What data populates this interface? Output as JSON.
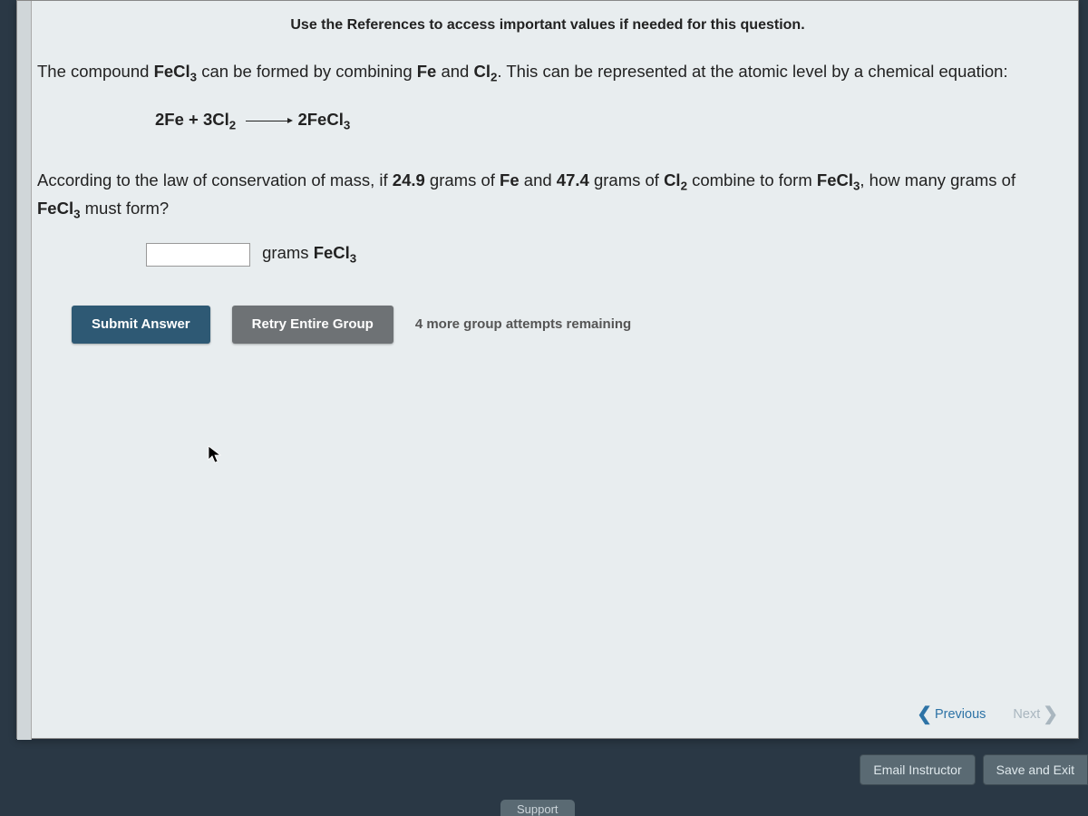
{
  "hint": "Use the References to access important values if needed for this question.",
  "question": {
    "intro_before_compound": "The compound ",
    "compound": "FeCl",
    "compound_sub": "3",
    "intro_mid": " can be formed by combining ",
    "reactant1": "Fe",
    "intro_and": " and ",
    "reactant2": "Cl",
    "reactant2_sub": "2",
    "intro_after": ". This can be represented at the atomic level by a chemical equation:"
  },
  "equation": {
    "left": "2Fe + 3Cl",
    "left_sub": "2",
    "right": "2FeCl",
    "right_sub": "3"
  },
  "conservation": {
    "pre": "According to the law of conservation of mass, if ",
    "mass1": "24.9",
    "mass1_unit": " grams of ",
    "species1": "Fe",
    "mid1": " and ",
    "mass2": "47.4",
    "mass2_unit": " grams of ",
    "species2": "Cl",
    "species2_sub": "2",
    "mid2": " combine to form ",
    "product": "FeCl",
    "product_sub": "3",
    "post": ", how many grams of ",
    "product2": "FeCl",
    "product2_sub": "3",
    "post2": " must form?"
  },
  "answer": {
    "unit_prefix": "grams ",
    "unit_species": "FeCl",
    "unit_sub": "3"
  },
  "buttons": {
    "submit": "Submit Answer",
    "retry": "Retry Entire Group",
    "attempts": "4 more group attempts remaining"
  },
  "nav": {
    "previous": "Previous",
    "next": "Next"
  },
  "footer": {
    "email": "Email Instructor",
    "save": "Save and Exit",
    "support": "Support"
  }
}
